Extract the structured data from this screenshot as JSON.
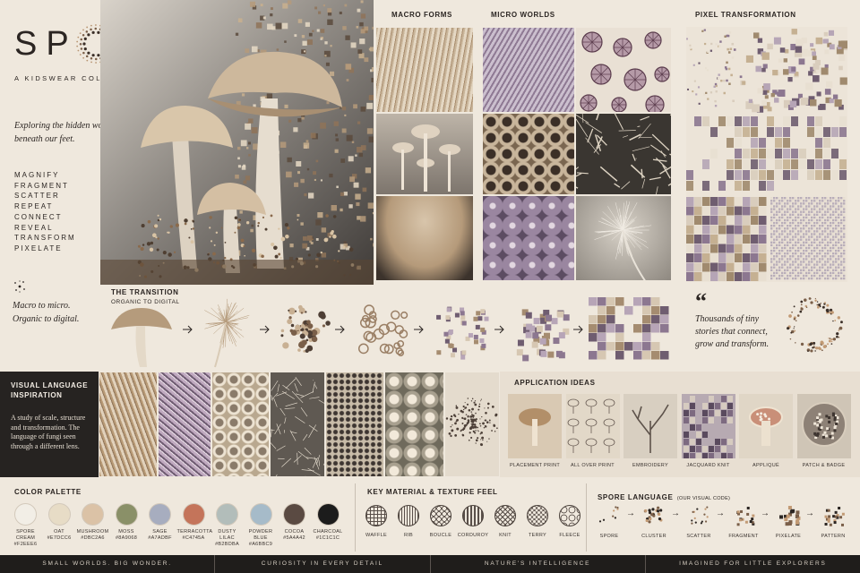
{
  "brand": {
    "title": "SPORE",
    "subtitle": "A KIDSWEAR COLLECTION",
    "tagline": "Exploring the hidden world beneath our feet.",
    "verbs": [
      "MAGNIFY",
      "FRAGMENT",
      "SCATTER",
      "REPEAT",
      "CONNECT",
      "REVEAL",
      "TRANSFORM",
      "PIXELATE"
    ],
    "closing": "Macro to micro. Organic to digital."
  },
  "sections": {
    "macro": "MACRO FORMS",
    "micro": "MICRO WORLDS",
    "pixel": "PIXEL TRANSFORMATION",
    "transition": "THE TRANSITION",
    "transition_sub": "ORGANIC TO DIGITAL",
    "visual": "VISUAL LANGUAGE INSPIRATION",
    "visual_body": "A study of scale, structure and transformation. The language of fungi seen through a different lens.",
    "application": "APPLICATION IDEAS",
    "palette": "COLOR PALETTE",
    "material": "KEY MATERIAL & TEXTURE FEEL",
    "spore_lang": "SPORE LANGUAGE",
    "spore_lang_note": "(OUR VISUAL CODE)"
  },
  "quote": {
    "mark": "“",
    "text": "Thousands of tiny stories that connect, grow and transform."
  },
  "applications": [
    "PLACEMENT PRINT",
    "ALL OVER PRINT",
    "EMBROIDERY",
    "JACQUARD KNIT",
    "APPLIQUÉ",
    "PATCH & BADGE"
  ],
  "palette": [
    {
      "name": "SPORE CREAM",
      "hex": "#F2EEE6"
    },
    {
      "name": "OAT",
      "hex": "#E7DCC6"
    },
    {
      "name": "MUSHROOM",
      "hex": "#DBC2A6"
    },
    {
      "name": "MOSS",
      "hex": "#8A9068"
    },
    {
      "name": "SAGE",
      "hex": "#A7ADBF"
    },
    {
      "name": "TERRACOTTA",
      "hex": "#C4745A"
    },
    {
      "name": "DUSTY LILAC",
      "hex": "#B2BDBA"
    },
    {
      "name": "POWDER BLUE",
      "hex": "#A6BBC9"
    },
    {
      "name": "COCOA",
      "hex": "#5A4A42"
    },
    {
      "name": "CHARCOAL",
      "hex": "#1C1C1C"
    }
  ],
  "materials": [
    "WAFFLE",
    "RIB",
    "BOUCLE",
    "CORDUROY",
    "KNIT",
    "TERRY",
    "FLEECE"
  ],
  "spore_steps": [
    "SPORE",
    "CLUSTER",
    "SCATTER",
    "FRAGMENT",
    "PIXELATE",
    "PATTERN"
  ],
  "footer": [
    "SMALL WORLDS. BIG WONDER.",
    "CURIOSITY IN EVERY DETAIL",
    "NATURE'S INTELLIGENCE",
    "IMAGINED FOR LITTLE EXPLORERS"
  ]
}
